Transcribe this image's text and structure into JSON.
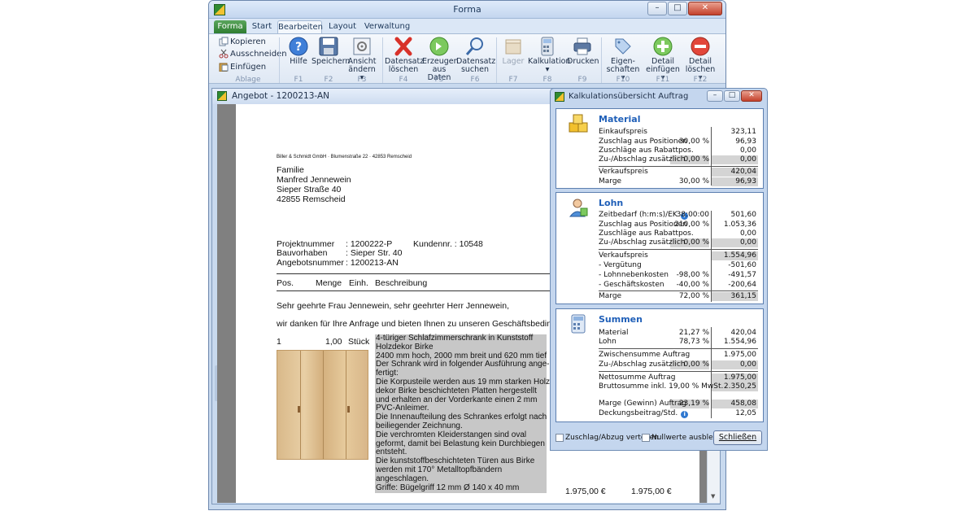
{
  "window": {
    "title": "Forma"
  },
  "ribbon": {
    "tabs": [
      {
        "label": "Forma"
      },
      {
        "label": "Start"
      },
      {
        "label": "Bearbeiten"
      },
      {
        "label": "Layout"
      },
      {
        "label": "Verwaltung"
      }
    ],
    "ablage": {
      "kopieren": "Kopieren",
      "ausschneiden": "Ausschneiden",
      "einfuegen": "Einfügen",
      "group": "Ablage"
    },
    "buttons": [
      {
        "label1": "Hilfe",
        "label2": "",
        "key": "F1"
      },
      {
        "label1": "Speichern",
        "label2": "",
        "key": "F2"
      },
      {
        "label1": "Ansicht",
        "label2": "ändern ▾",
        "key": "F3"
      },
      {
        "label1": "Datensatz",
        "label2": "löschen",
        "key": "F4"
      },
      {
        "label1": "Erzeugen",
        "label2": "aus Daten",
        "key": "F5"
      },
      {
        "label1": "Datensatz",
        "label2": "suchen",
        "key": "F6"
      },
      {
        "label1": "Lager",
        "label2": "",
        "key": "F7"
      },
      {
        "label1": "Kalkulation",
        "label2": "▾",
        "key": "F8"
      },
      {
        "label1": "Drucken",
        "label2": "",
        "key": "F9"
      },
      {
        "label1": "Eigen-",
        "label2": "schaften ▾",
        "key": "F10"
      },
      {
        "label1": "Detail",
        "label2": "einfügen ▾",
        "key": "F11"
      },
      {
        "label1": "Detail",
        "label2": "löschen ▾",
        "key": "F12"
      }
    ]
  },
  "document": {
    "title": "Angebot - 1200213-AN",
    "sender": "Biller & Schmidt GmbH · Blumenstraße 22 · 42853 Remscheid",
    "address": [
      "Familie",
      "Manfred Jennewein",
      "Sieper Straße 40",
      "42855 Remscheid"
    ],
    "meta": {
      "projekt_label": "Projektnummer",
      "projekt_value": ": 1200222-P",
      "kunde_label": "Kundennr. : 10548",
      "bau_label": "Bauvorhaben",
      "bau_value": ": Sieper Str. 40",
      "angebot_label": "Angebotsnummer",
      "angebot_value": ": 1200213-AN"
    },
    "columns": {
      "pos": "Pos.",
      "menge": "Menge",
      "einh": "Einh.",
      "beschreibung": "Beschreibung"
    },
    "greeting": "Sehr geehrte Frau Jennewein, sehr geehrter Herr Jennewein,",
    "intro": "wir danken für Ihre Anfrage und bieten Ihnen zu unseren Geschäftsbedingungen",
    "item": {
      "pos": "1",
      "menge": "1,00",
      "einh": "Stück",
      "lines": [
        "4-türiger Schlafzimmerschrank in Kunststoff",
        "Holzdekor Birke",
        "2400 mm hoch, 2000 mm breit und 620 mm tief",
        "Der Schrank wird in folgender Ausführung ange-",
        "fertigt:",
        "Die Korpusteile werden aus 19 mm starken Holz-",
        "dekor Birke beschichteten Platten hergestellt",
        "und erhalten an der Vorderkante einen 2 mm",
        "PVC-Anleimer.",
        "Die Innenaufteilung des Schrankes erfolgt nach",
        "beiliegender Zeichnung.",
        "Die verchromten Kleiderstangen sind oval",
        "geformt, damit bei Belastung kein Durchbiegen",
        "entsteht.",
        "Die kunststoffbeschichteten Türen aus Birke",
        "werden mit 170° Metalltopfbändern",
        "angeschlagen.",
        "Griffe: Bügelgriff 12 mm Ø 140 x 40 mm"
      ],
      "ep": "1.975,00 €",
      "gp": "1.975,00 €"
    }
  },
  "dialog": {
    "title": "Kalkulationsübersicht Auftrag",
    "material": {
      "title": "Material",
      "rows": [
        {
          "lbl": "Einkaufspreis",
          "pct": "",
          "val": "323,11"
        },
        {
          "lbl": "Zuschlag aus Positionen",
          "pct": "30,00 %",
          "val": "96,93"
        },
        {
          "lbl": "Zuschläge aus Rabattpos.",
          "pct": "",
          "val": "0,00"
        },
        {
          "lbl": "Zu-/Abschlag zusätzlich",
          "pct": "0,00 %",
          "val": "0,00"
        },
        {
          "lbl": "Verkaufspreis",
          "pct": "",
          "val": "420,04"
        },
        {
          "lbl": "Marge",
          "pct": "30,00 %",
          "val": "96,93"
        }
      ]
    },
    "lohn": {
      "title": "Lohn",
      "rows": [
        {
          "lbl": "Zeitbedarf (h:m:s)/EK",
          "pct": "38:00:00",
          "val": "501,60"
        },
        {
          "lbl": "Zuschlag aus Positionen",
          "pct": "210,00 %",
          "val": "1.053,36"
        },
        {
          "lbl": "Zuschläge aus Rabattpos.",
          "pct": "",
          "val": "0,00"
        },
        {
          "lbl": "Zu-/Abschlag zusätzlich",
          "pct": "0,00 %",
          "val": "0,00"
        },
        {
          "lbl": "Verkaufspreis",
          "pct": "",
          "val": "1.554,96"
        },
        {
          "lbl": "- Vergütung",
          "pct": "",
          "val": "-501,60"
        },
        {
          "lbl": "- Lohnnebenkosten",
          "pct": "-98,00 %",
          "val": "-491,57"
        },
        {
          "lbl": "- Geschäftskosten",
          "pct": "-40,00 %",
          "val": "-200,64"
        },
        {
          "lbl": "Marge",
          "pct": "72,00 %",
          "val": "361,15"
        }
      ]
    },
    "summen": {
      "title": "Summen",
      "rows": [
        {
          "lbl": "Material",
          "pct": "21,27 %",
          "val": "420,04"
        },
        {
          "lbl": "Lohn",
          "pct": "78,73 %",
          "val": "1.554,96"
        },
        {
          "lbl": "Zwischensumme Auftrag",
          "pct": "",
          "val": "1.975,00"
        },
        {
          "lbl": "Zu-/Abschlag zusätzlich",
          "pct": "0,00 %",
          "val": "0,00"
        },
        {
          "lbl": "Nettosumme Auftrag",
          "pct": "",
          "val": "1.975,00"
        },
        {
          "lbl": "Bruttosumme inkl. 19,00 % MwSt.",
          "pct": "",
          "val": "2.350,25"
        },
        {
          "lbl": "Marge (Gewinn) Auftrag",
          "pct": "23,19 %",
          "val": "458,08"
        },
        {
          "lbl": "Deckungsbeitrag/Std.",
          "pct": "",
          "val": "12,05"
        }
      ]
    },
    "footer": {
      "verteilen": "Zuschlag/Abzug verteilen",
      "nullwerte": "Nullwerte ausblenden",
      "schliessen": "Schließen"
    }
  }
}
